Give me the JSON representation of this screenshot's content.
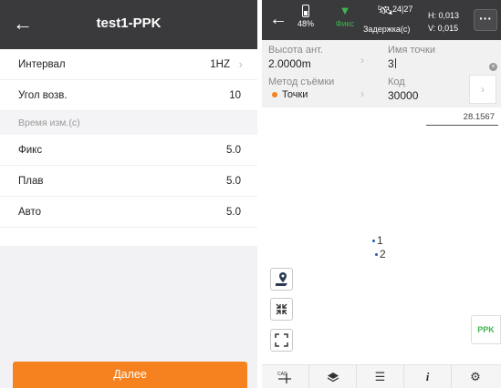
{
  "left": {
    "header": {
      "title": "test1-PPK"
    },
    "settings": [
      {
        "label": "Интервал",
        "value": "1HZ",
        "has_chevron": true
      },
      {
        "label": "Угол возв.",
        "value": "10",
        "has_chevron": false
      }
    ],
    "section_title": "Время изм.(с)",
    "times": [
      {
        "label": "Фикс",
        "value": "5.0"
      },
      {
        "label": "Плав",
        "value": "5.0"
      },
      {
        "label": "Авто",
        "value": "5.0"
      }
    ],
    "next_button": "Далее",
    "accent_color": "#f5821f"
  },
  "right": {
    "status": {
      "battery": "48%",
      "fix_label": "Фикс",
      "satellites": "24|27",
      "delay_label": "Задержка(с)",
      "h": "H: 0,013",
      "v": "V: 0,015",
      "more_label": "···"
    },
    "fields": {
      "antenna_height_label": "Высота ант.",
      "antenna_height_value": "2.0000m",
      "point_name_label": "Имя точки",
      "point_name_value": "3",
      "method_label": "Метод съёмки",
      "method_value": "Точки",
      "code_label": "Код",
      "code_value": "30000"
    },
    "scale_value": "28.1567",
    "points": [
      "1",
      "2"
    ],
    "ppk_label": "PPK",
    "bottom_bar": {
      "cad_label": "CAD",
      "icons": [
        "cad-icon",
        "layers-icon",
        "menu-icon",
        "info-icon",
        "settings-icon"
      ]
    },
    "fix_color": "#3fb34f"
  }
}
